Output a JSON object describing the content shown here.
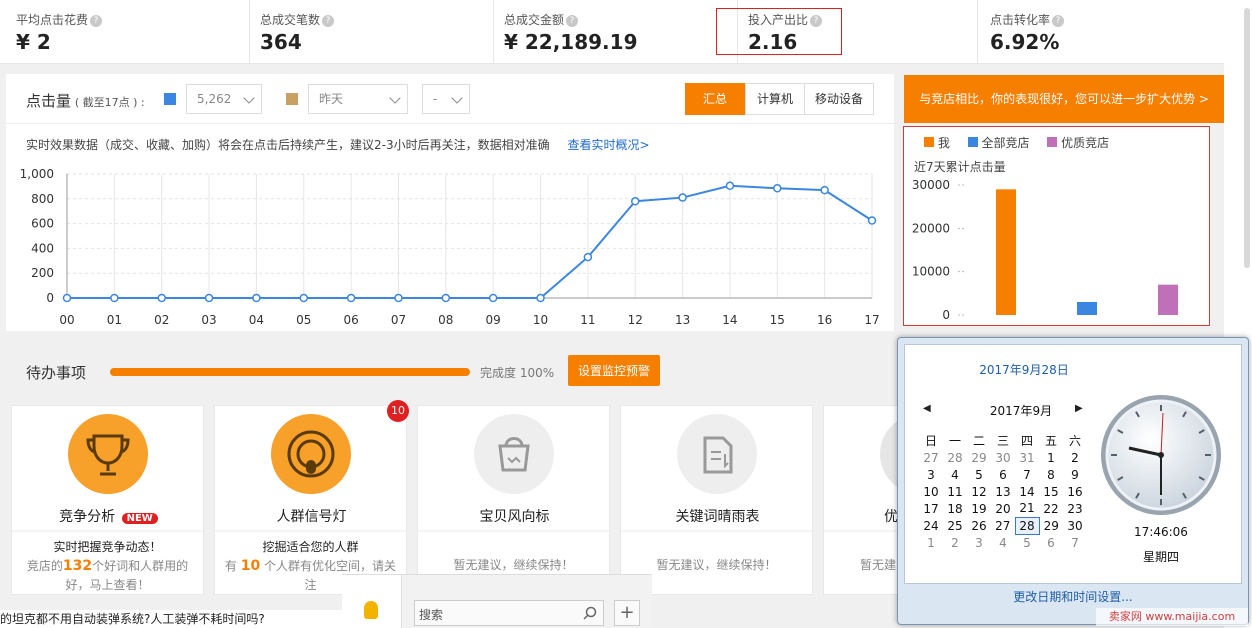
{
  "stats": [
    {
      "label": "平均点击花费",
      "value": "¥ 2"
    },
    {
      "label": "总成交笔数",
      "value": "364"
    },
    {
      "label": "总成交金额",
      "value": "¥ 22,189.19"
    },
    {
      "label": "投入产出比",
      "value": "2.16"
    },
    {
      "label": "点击转化率",
      "value": "6.92%"
    }
  ],
  "chart_header": {
    "title": "点击量",
    "cutoff": "( 截至17点 ) :",
    "dropdown1": "5,262",
    "dropdown2": "昨天",
    "dropdown3": "-",
    "tabs": [
      "汇总",
      "计算机",
      "移动设备"
    ],
    "notice": "实时效果数据（成交、收藏、加购）将会在点击后持续产生，建议2-3小时后再关注，数据相对准确",
    "notice_link": "查看实时概况>",
    "colors": {
      "today": "#3a86e0",
      "compare": "#c9a063",
      "accent": "#f77f00"
    }
  },
  "chart_data": {
    "type": "line",
    "x": [
      "00",
      "01",
      "02",
      "03",
      "04",
      "05",
      "06",
      "07",
      "08",
      "09",
      "10",
      "11",
      "12",
      "13",
      "14",
      "15",
      "16",
      "17"
    ],
    "series": [
      {
        "values": [
          0,
          0,
          0,
          0,
          0,
          0,
          0,
          0,
          0,
          0,
          0,
          330,
          780,
          810,
          905,
          885,
          870,
          625
        ]
      }
    ],
    "ylim": [
      0,
      1000
    ],
    "yticks": [
      "1,000",
      "800",
      "600",
      "400",
      "200",
      "0"
    ],
    "grid": true
  },
  "comparison": {
    "banner": "与竞店相比，你的表现很好，您可以进一步扩大优势 >",
    "legend": [
      {
        "name": "我",
        "color": "#f77f00"
      },
      {
        "name": "全部竞店",
        "color": "#3a86e0"
      },
      {
        "name": "优质竞店",
        "color": "#c070b8"
      }
    ],
    "subtitle": "近7天累计点击量",
    "yticks": [
      "30000",
      "20000",
      "10000",
      "0"
    ],
    "chart_data": {
      "type": "bar",
      "categories": [
        "我",
        "全部竞店",
        "优质竞店"
      ],
      "values": [
        29000,
        3000,
        7000
      ],
      "ylim": [
        0,
        30000
      ]
    }
  },
  "todo": {
    "title": "待办事项",
    "progress": 1.0,
    "progress_label": "完成度 100%",
    "alert_button": "设置监控预警",
    "cards": [
      {
        "title": "竞争分析",
        "badge": "NEW",
        "line1": "实时把握竞争动态！",
        "line2a": "竞店的",
        "highlight": "132",
        "line2b": "个好词和人群用的",
        "line3": "好，马上查看！"
      },
      {
        "title": "人群信号灯",
        "count": "10",
        "line1": "挖掘适合您的人群",
        "line2a": "有 ",
        "highlight": "10",
        "line2b": " 个人群有优化空间，请关",
        "line3": "注"
      },
      {
        "title": "宝贝风向标",
        "line1": "暂无建议，继续保持！"
      },
      {
        "title": "关键词晴雨表",
        "line1": "暂无建议，继续保持！"
      },
      {
        "title": "优",
        "line1": "暂无建"
      }
    ]
  },
  "calendar": {
    "date_title": "2017年9月28日",
    "month": "2017年9月",
    "weekdays": [
      "日",
      "一",
      "二",
      "三",
      "四",
      "五",
      "六"
    ],
    "weeks": [
      [
        "27",
        "28",
        "29",
        "30",
        "31",
        "1",
        "2"
      ],
      [
        "3",
        "4",
        "5",
        "6",
        "7",
        "8",
        "9"
      ],
      [
        "10",
        "11",
        "12",
        "13",
        "14",
        "15",
        "16"
      ],
      [
        "17",
        "18",
        "19",
        "20",
        "21",
        "22",
        "23"
      ],
      [
        "24",
        "25",
        "26",
        "27",
        "28",
        "29",
        "30"
      ],
      [
        "1",
        "2",
        "3",
        "4",
        "5",
        "6",
        "7"
      ]
    ],
    "time": "17:46:06",
    "weekday": "星期四",
    "change_link": "更改日期和时间设置..."
  },
  "taskbar": {
    "search_placeholder": "搜索",
    "add": "+",
    "bottom_text": "的坦克都不用自动装弹系统?人工装弹不耗时间吗?",
    "watermark": "卖家网 www.maijia.com"
  }
}
